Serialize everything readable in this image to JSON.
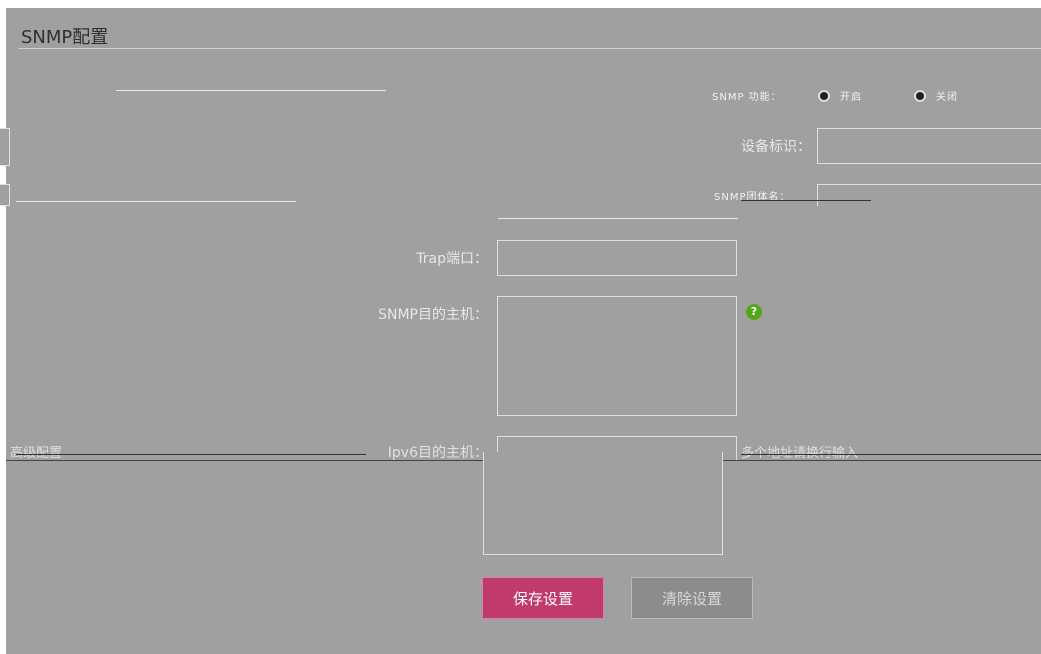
{
  "panel": {
    "title": "SNMP配置"
  },
  "form": {
    "snmp_switch_label": "SNMP 功能：",
    "snmp_on_label": "开启",
    "snmp_off_label": "关闭",
    "device_id_label": "设备标识：",
    "device_id_value": "",
    "snmp_community_label": "SNMP团体名：",
    "trap_port_label": "Trap端口：",
    "trap_port_value": "",
    "snmp_target_label": "SNMP目的主机：",
    "snmp_target_value": "",
    "help_symbol": "?",
    "extra_hosts_label": "Ipv6目的主机：",
    "extra_hint": "多个地址请换行输入",
    "left_hint": "高级配置"
  },
  "buttons": {
    "save": "保存设置",
    "reset": "清除设置"
  },
  "colors": {
    "save": "#c03a6e",
    "help": "#55a51b",
    "panel_bg": "#a0a0a0"
  }
}
